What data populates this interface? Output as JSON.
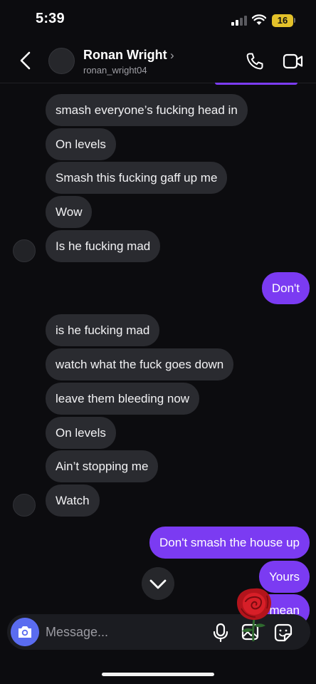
{
  "status_bar": {
    "time": "5:39",
    "battery": "16"
  },
  "header": {
    "contact_name": "Ronan Wright",
    "username": "ronan_wright04"
  },
  "messages": [
    {
      "text": "smash everyone’s fucking head in"
    },
    {
      "text": "On levels"
    },
    {
      "text": "Smash this fucking gaff up me"
    },
    {
      "text": "Wow"
    },
    {
      "text": "Is he fucking mad"
    },
    {
      "text": "Don't"
    },
    {
      "text": "is he fucking mad"
    },
    {
      "text": "watch what the fuck goes down"
    },
    {
      "text": "leave them bleeding now"
    },
    {
      "text": "On levels"
    },
    {
      "text": "Ain’t stopping me"
    },
    {
      "text": "Watch"
    },
    {
      "text": "Don't smash the house up"
    },
    {
      "text": "Yours"
    },
    {
      "text": "I mean"
    }
  ],
  "composer": {
    "placeholder": "Message..."
  },
  "icons": {
    "back": "chevron-left-icon",
    "call": "phone-icon",
    "video": "video-camera-icon",
    "scroll": "chevron-down-icon",
    "camera": "camera-icon",
    "mic": "microphone-icon",
    "gallery": "image-icon",
    "sticker": "sticker-icon"
  },
  "colors": {
    "background": "#0c0c0f",
    "incoming_bubble": "#2a2b30",
    "outgoing_bubble": "#7b3bf2",
    "camera_button": "#5a6cf0",
    "battery": "#e3c12a"
  }
}
